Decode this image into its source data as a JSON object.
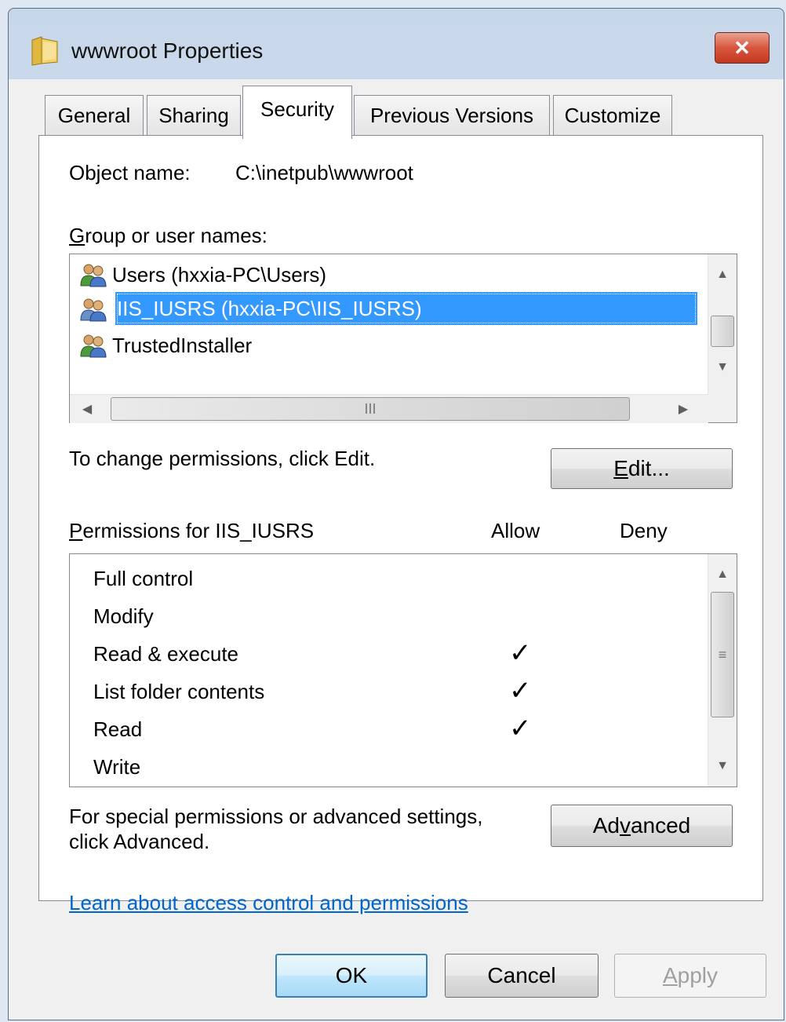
{
  "window": {
    "title": "wwwroot Properties",
    "close_symbol": "✕"
  },
  "tabs": [
    {
      "label": "General"
    },
    {
      "label": "Sharing"
    },
    {
      "label": "Security",
      "active": true
    },
    {
      "label": "Previous Versions"
    },
    {
      "label": "Customize"
    }
  ],
  "object": {
    "label": "Object name:",
    "value": "C:\\inetpub\\wwwroot"
  },
  "groups": {
    "label": "Group or user names:",
    "label_accel": "G",
    "label_rest": "roup or user names:",
    "items": [
      {
        "name": "Users (hxxia-PC\\Users)"
      },
      {
        "name": "IIS_IUSRS (hxxia-PC\\IIS_IUSRS)",
        "selected": true
      },
      {
        "name": "TrustedInstaller"
      }
    ],
    "hscroll_grip": "III"
  },
  "change_text": "To change permissions, click Edit.",
  "edit_button": {
    "label": "Edit...",
    "accel": "E",
    "rest": "dit..."
  },
  "permissions": {
    "label": "Permissions for IIS_IUSRS",
    "label_accel": "P",
    "label_rest": "ermissions for IIS_IUSRS",
    "allow_header": "Allow",
    "deny_header": "Deny",
    "check_symbol": "✓",
    "rows": [
      {
        "name": "Full control",
        "allow": false,
        "deny": false
      },
      {
        "name": "Modify",
        "allow": false,
        "deny": false
      },
      {
        "name": "Read & execute",
        "allow": true,
        "deny": false
      },
      {
        "name": "List folder contents",
        "allow": true,
        "deny": false
      },
      {
        "name": "Read",
        "allow": true,
        "deny": false
      },
      {
        "name": "Write",
        "allow": false,
        "deny": false
      }
    ]
  },
  "advanced": {
    "text_line1": "For special permissions or advanced settings,",
    "text_line2": "click Advanced.",
    "button_label": "Advanced",
    "button_pre": "Ad",
    "button_accel": "v",
    "button_post": "anced"
  },
  "link": {
    "label": "Learn about access control and permissions"
  },
  "footer": {
    "ok": "OK",
    "cancel": "Cancel",
    "apply": "Apply",
    "apply_accel": "A",
    "apply_rest": "pply"
  },
  "colors": {
    "selection": "#3399ff",
    "link": "#0066cc",
    "close": "#c2381f"
  }
}
